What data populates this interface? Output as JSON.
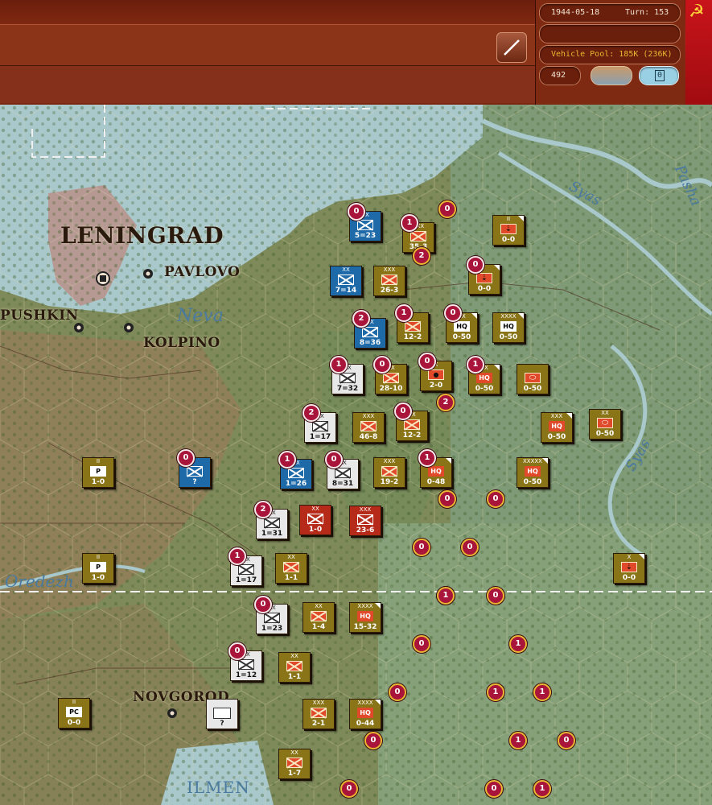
{
  "header": {
    "date": "1944-05-18",
    "turn_label": "Turn: 153",
    "vehicle_pool": "Vehicle Pool: 185K (236K)",
    "points": "492",
    "counter_value": "0",
    "colors": {
      "bar": "#7a2610",
      "flag": "#c8141a",
      "gold_text": "#e8b830"
    }
  },
  "map": {
    "cities": [
      {
        "name": "LENINGRAD",
        "size": "large"
      },
      {
        "name": "PAVLOVO",
        "size": "small"
      },
      {
        "name": "PUSHKIN",
        "size": "small"
      },
      {
        "name": "KOLPINO",
        "size": "small"
      },
      {
        "name": "NOVGOROD",
        "size": "small"
      }
    ],
    "water_labels": [
      "Neva",
      "Syas",
      "Pasha",
      "Syas",
      "Oredezh",
      "ILMEN"
    ],
    "units": [
      {
        "id": "u1",
        "color": "blue",
        "size": "XX",
        "kind": "inf",
        "value": "5=23",
        "badge": "0",
        "stack": false
      },
      {
        "id": "u2",
        "color": "olive",
        "size": "XXX",
        "kind": "inf",
        "value": "35-3",
        "badge": "1",
        "stack": true
      },
      {
        "id": "u3",
        "color": "olive",
        "size": "II",
        "kind": "eng",
        "value": "0-0",
        "badge": "",
        "stack": false
      },
      {
        "id": "u4",
        "color": "blue",
        "size": "XX",
        "kind": "inf",
        "value": "7=14",
        "badge": "",
        "stack": true
      },
      {
        "id": "u5",
        "color": "olive",
        "size": "XXX",
        "kind": "inf",
        "value": "26-3",
        "badge": "",
        "stack": true
      },
      {
        "id": "u6",
        "color": "olive",
        "size": "",
        "kind": "eng",
        "value": "0-0",
        "badge": "0",
        "stack": false
      },
      {
        "id": "u7",
        "color": "blue",
        "size": "XX",
        "kind": "inf",
        "value": "8=36",
        "badge": "2",
        "stack": true
      },
      {
        "id": "u8",
        "color": "olive",
        "size": "",
        "kind": "inf",
        "value": "12-2",
        "badge": "1",
        "stack": false
      },
      {
        "id": "u9",
        "color": "olive",
        "size": "XX",
        "kind": "hq",
        "value": "0-50",
        "badge": "0",
        "stack": false
      },
      {
        "id": "u10",
        "color": "olive",
        "size": "XXXX",
        "kind": "hq",
        "value": "0-50",
        "badge": "",
        "stack": false
      },
      {
        "id": "u11",
        "color": "grey",
        "size": "XX",
        "kind": "inf",
        "value": "7=32",
        "badge": "1",
        "stack": true
      },
      {
        "id": "u12",
        "color": "olive",
        "size": "XX",
        "kind": "inf",
        "value": "28-10",
        "badge": "0",
        "stack": true
      },
      {
        "id": "u13",
        "color": "olive",
        "size": "X",
        "kind": "art",
        "value": "2-0",
        "badge": "0",
        "stack": false
      },
      {
        "id": "u14",
        "color": "olive",
        "size": "XX",
        "kind": "hqr",
        "value": "0-50",
        "badge": "1",
        "stack": false
      },
      {
        "id": "u15",
        "color": "olive",
        "size": "",
        "kind": "tank",
        "value": "0-50",
        "badge": "",
        "stack": true
      },
      {
        "id": "u16",
        "color": "grey",
        "size": "XX",
        "kind": "inf",
        "value": "1=17",
        "badge": "2",
        "stack": true
      },
      {
        "id": "u17",
        "color": "olive",
        "size": "XXX",
        "kind": "inf",
        "value": "46-8",
        "badge": "",
        "stack": true
      },
      {
        "id": "u18",
        "color": "olive",
        "size": "XX",
        "kind": "inf",
        "value": "12-2",
        "badge": "0",
        "stack": false
      },
      {
        "id": "u19",
        "color": "olive",
        "size": "XXX",
        "kind": "hqr",
        "value": "0-50",
        "badge": "",
        "stack": true
      },
      {
        "id": "u20",
        "color": "olive",
        "size": "XX",
        "kind": "tank",
        "value": "0-50",
        "badge": "",
        "stack": false
      },
      {
        "id": "u21",
        "color": "olive",
        "size": "II",
        "kind": "P",
        "value": "1-0",
        "badge": "",
        "stack": false
      },
      {
        "id": "u22",
        "color": "blue",
        "size": "",
        "kind": "inf",
        "value": "?",
        "badge": "0",
        "stack": false
      },
      {
        "id": "u23",
        "color": "blue",
        "size": "XX",
        "kind": "inf",
        "value": "1=26",
        "badge": "1",
        "stack": true
      },
      {
        "id": "u24",
        "color": "grey",
        "size": "XX",
        "kind": "inf",
        "value": "8=31",
        "badge": "0",
        "stack": true
      },
      {
        "id": "u25",
        "color": "olive",
        "size": "XXX",
        "kind": "inf",
        "value": "19-2",
        "badge": "",
        "stack": false
      },
      {
        "id": "u26",
        "color": "olive",
        "size": "",
        "kind": "hqr",
        "value": "0-48",
        "badge": "1",
        "stack": false
      },
      {
        "id": "u27",
        "color": "olive",
        "size": "XXXXX",
        "kind": "hqr",
        "value": "0-50",
        "badge": "",
        "stack": false
      },
      {
        "id": "u28",
        "color": "grey",
        "size": "XX",
        "kind": "inf",
        "value": "1=31",
        "badge": "2",
        "stack": true
      },
      {
        "id": "u29",
        "color": "dred",
        "size": "XX",
        "kind": "inf",
        "value": "1-0",
        "badge": "",
        "stack": false
      },
      {
        "id": "u30",
        "color": "dred",
        "size": "XXX",
        "kind": "inf",
        "value": "23-6",
        "badge": "",
        "stack": false
      },
      {
        "id": "u31",
        "color": "olive",
        "size": "II",
        "kind": "P",
        "value": "1-0",
        "badge": "",
        "stack": false
      },
      {
        "id": "u32",
        "color": "grey",
        "size": "XX",
        "kind": "inf",
        "value": "1=17",
        "badge": "1",
        "stack": false
      },
      {
        "id": "u33",
        "color": "olive",
        "size": "XX",
        "kind": "inf",
        "value": "1-1",
        "badge": "",
        "stack": false
      },
      {
        "id": "u34",
        "color": "olive",
        "size": "X",
        "kind": "eng",
        "value": "0-0",
        "badge": "",
        "stack": false
      },
      {
        "id": "u35",
        "color": "grey",
        "size": "XX",
        "kind": "inf",
        "value": "1=23",
        "badge": "0",
        "stack": true
      },
      {
        "id": "u36",
        "color": "olive",
        "size": "XX",
        "kind": "inf",
        "value": "1-4",
        "badge": "",
        "stack": false
      },
      {
        "id": "u37",
        "color": "olive",
        "size": "XXXX",
        "kind": "hqr",
        "value": "15-32",
        "badge": "",
        "stack": false
      },
      {
        "id": "u38",
        "color": "grey",
        "size": "XX",
        "kind": "inf",
        "value": "1=12",
        "badge": "0",
        "stack": false
      },
      {
        "id": "u39",
        "color": "olive",
        "size": "XX",
        "kind": "inf",
        "value": "1-1",
        "badge": "",
        "stack": false
      },
      {
        "id": "u40",
        "color": "olive",
        "size": "II",
        "kind": "PC",
        "value": "0-0",
        "badge": "",
        "stack": false
      },
      {
        "id": "u41",
        "color": "grey",
        "size": "",
        "kind": "blank",
        "value": "?",
        "badge": "",
        "stack": false
      },
      {
        "id": "u42",
        "color": "olive",
        "size": "XXX",
        "kind": "inf",
        "value": "2-1",
        "badge": "",
        "stack": true
      },
      {
        "id": "u43",
        "color": "olive",
        "size": "XXXX",
        "kind": "hqr",
        "value": "0-44",
        "badge": "",
        "stack": false
      },
      {
        "id": "u44",
        "color": "olive",
        "size": "XX",
        "kind": "inf",
        "value": "1-7",
        "badge": "",
        "stack": true
      }
    ],
    "markers": [
      "0",
      "2",
      "0",
      "2",
      "0",
      "0",
      "0",
      "0",
      "0",
      "0",
      "1",
      "1",
      "0",
      "1",
      "1",
      "1",
      "0",
      "0",
      "0",
      "1",
      "0"
    ]
  }
}
